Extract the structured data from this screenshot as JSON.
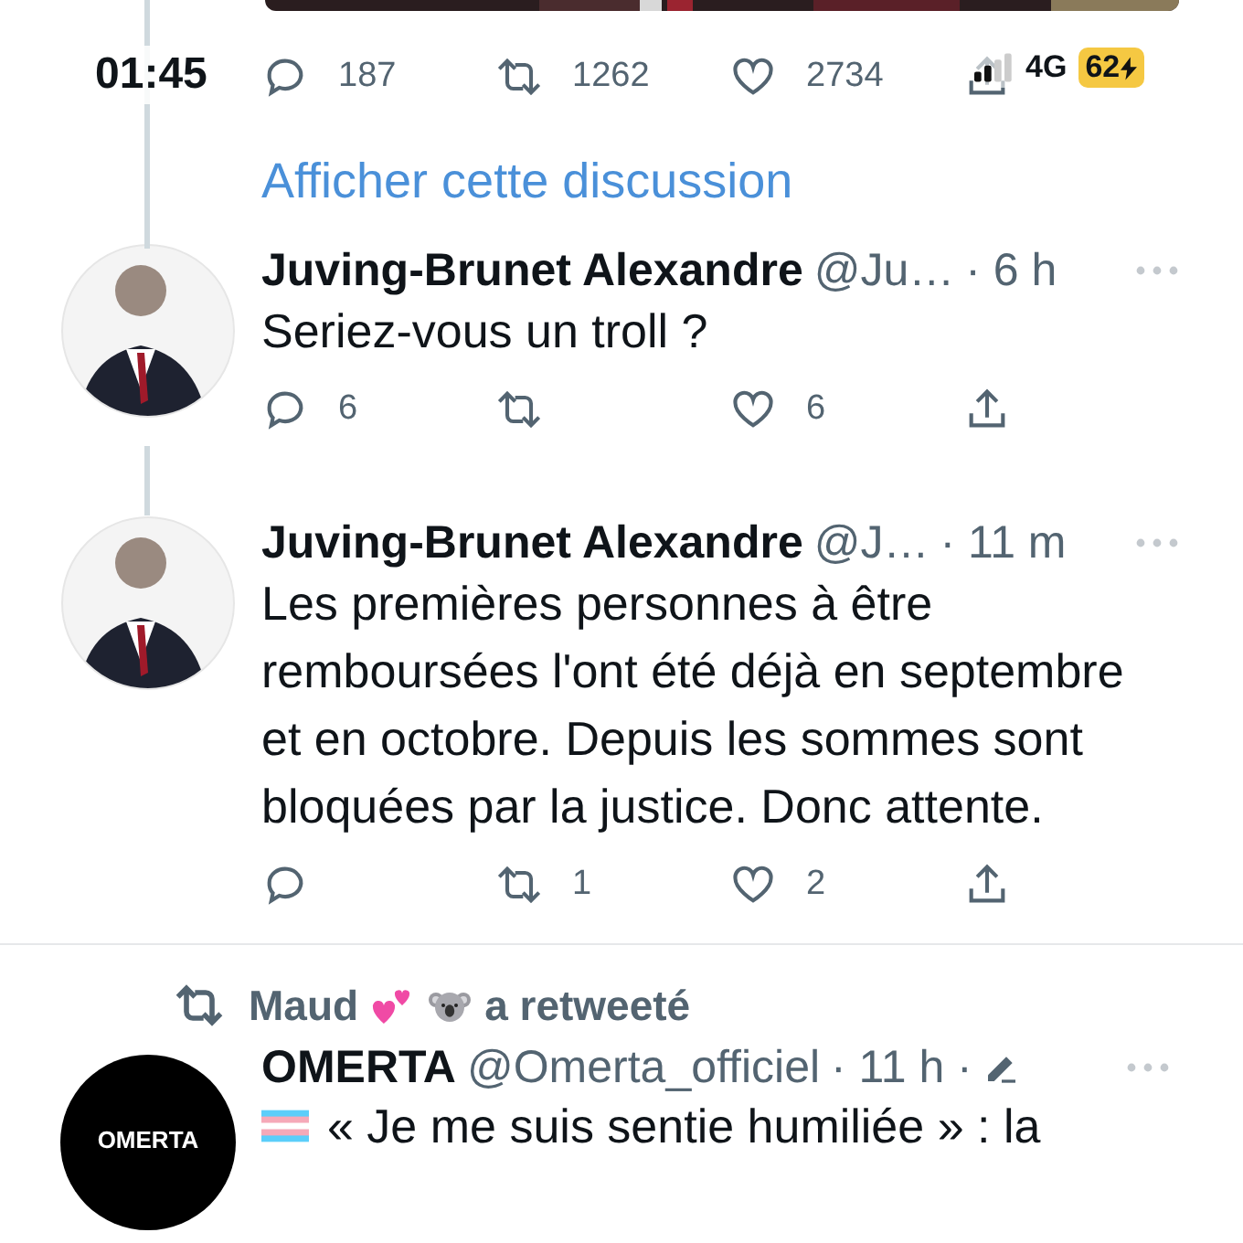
{
  "status_bar": {
    "time": "01:45",
    "network": "4G",
    "battery": "62",
    "charging": true
  },
  "top_tweet": {
    "replies": "187",
    "retweets": "1262",
    "likes": "2734"
  },
  "show_thread_link": "Afficher cette discussion",
  "replies": [
    {
      "name": "Juving-Brunet Alexandre",
      "handle": "@Ju…",
      "time": "· 6 h",
      "text": "Seriez-vous un troll ?",
      "reply_count": "6",
      "like_count": "6"
    },
    {
      "name": "Juving-Brunet Alexandre",
      "handle": "@J…",
      "time": "· 11 m",
      "text": "Les premières personnes à être remboursées l'ont été déjà en septembre et en octobre. Depuis les sommes sont bloquées par la justice. Donc attente.",
      "retweet_count": "1",
      "like_count": "2"
    }
  ],
  "retweet": {
    "retweeted_by": "Maud",
    "label": "a retweeté",
    "tweet": {
      "name": "OMERTA",
      "handle": "@Omerta_officiel",
      "time": "· 11 h ·",
      "edited": true,
      "avatar_label": "OMERTA",
      "text": "« Je me suis sentie humiliée » : la"
    }
  }
}
